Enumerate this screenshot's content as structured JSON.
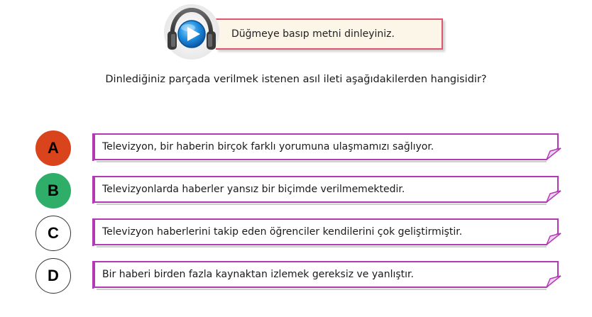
{
  "audio": {
    "instruction": "Düğmeye basıp metni dinleyiniz.",
    "icon": "headphones-play-icon"
  },
  "question": {
    "text": "Dinlediğiniz parçada verilmek istenen asıl ileti aşağıdakilerden hangisidir?"
  },
  "colors": {
    "accent": "#b43ab5",
    "audio_border": "#e1556e",
    "option_a": "#d9441c",
    "option_b": "#2fae6a"
  },
  "options": [
    {
      "letter": "A",
      "text": "Televizyon, bir haberin birçok farklı yorumuna ulaşmamızı sağlıyor.",
      "state": "wrong"
    },
    {
      "letter": "B",
      "text": "Televizyonlarda haberler yansız bir biçimde verilmemektedir.",
      "state": "correct"
    },
    {
      "letter": "C",
      "text": "Televizyon haberlerini takip eden öğrenciler kendilerini çok geliştirmiştir.",
      "state": "default"
    },
    {
      "letter": "D",
      "text": "Bir haberi birden fazla kaynaktan izlemek gereksiz ve yanlıştır.",
      "state": "default"
    }
  ]
}
